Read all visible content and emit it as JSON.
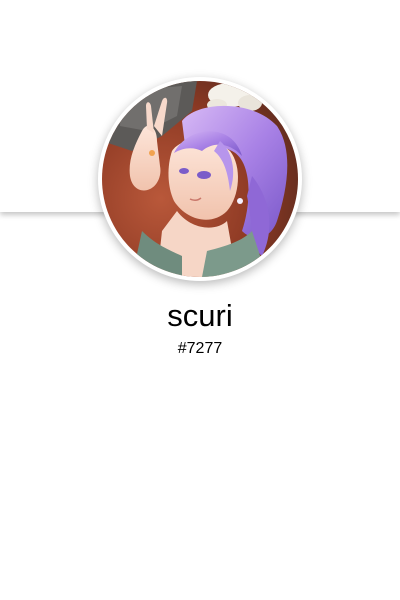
{
  "profile": {
    "username": "scuri",
    "discriminator": "#7277"
  }
}
